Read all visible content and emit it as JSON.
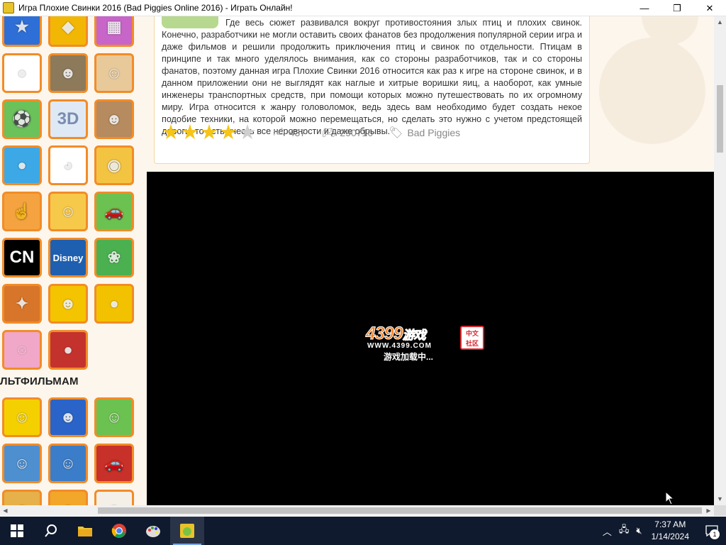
{
  "window": {
    "title": "Игра Плохие Свинки 2016 (Bad Piggies Online 2016) - Играть Онлайн!",
    "minimize_glyph": "—",
    "maximize_glyph": "❐",
    "close_glyph": "✕"
  },
  "sidebar": {
    "section_heading": "ЛЬТФИЛЬМАМ",
    "thumbs_top": [
      {
        "name": "game-thumb-stars",
        "label": "",
        "bg": "#2d6fd6",
        "glyph": "★"
      },
      {
        "name": "game-thumb-geometry",
        "label": "",
        "bg": "#f2b705",
        "glyph": "◆"
      },
      {
        "name": "game-thumb-blocks",
        "label": "",
        "bg": "#c765c9",
        "glyph": "▦"
      },
      {
        "name": "game-thumb-bubbles",
        "label": "",
        "bg": "#ffffff",
        "glyph": "●"
      },
      {
        "name": "game-thumb-jetpack",
        "label": "",
        "bg": "#8c7a5b",
        "glyph": "☻"
      },
      {
        "name": "game-thumb-viking",
        "label": "",
        "bg": "#e8c99a",
        "glyph": "☺"
      },
      {
        "name": "game-thumb-football",
        "label": "",
        "bg": "#6bc15a",
        "glyph": "⚽"
      },
      {
        "name": "game-thumb-3d",
        "label": "3D",
        "bg": "#dfe9f5",
        "glyph": ""
      },
      {
        "name": "game-thumb-gangster",
        "label": "",
        "bg": "#b58b5f",
        "glyph": "☻"
      },
      {
        "name": "game-thumb-angry-birds",
        "label": "",
        "bg": "#3da8e6",
        "glyph": "●"
      },
      {
        "name": "game-thumb-panda",
        "label": "",
        "bg": "#ffffff",
        "glyph": "◕"
      },
      {
        "name": "game-thumb-cut-rope",
        "label": "",
        "bg": "#f3c442",
        "glyph": "◉"
      },
      {
        "name": "game-thumb-clicker",
        "label": "",
        "bg": "#f4a340",
        "glyph": "☝"
      },
      {
        "name": "game-thumb-adam-eve",
        "label": "",
        "bg": "#f7c94a",
        "glyph": "☺"
      },
      {
        "name": "game-thumb-wheely",
        "label": "",
        "bg": "#6cc250",
        "glyph": "🚗"
      },
      {
        "name": "game-thumb-cartoon-network",
        "label": "CN",
        "bg": "#000000",
        "glyph": ""
      },
      {
        "name": "game-thumb-disney",
        "label": "Disney",
        "bg": "#1e5fb0",
        "glyph": ""
      },
      {
        "name": "game-thumb-candy",
        "label": "",
        "bg": "#4bb04f",
        "glyph": "❀"
      },
      {
        "name": "game-thumb-cannon",
        "label": "",
        "bg": "#d7752a",
        "glyph": "✦"
      },
      {
        "name": "game-thumb-brawl",
        "label": "",
        "bg": "#f5c400",
        "glyph": "☻"
      },
      {
        "name": "game-thumb-among-us",
        "label": "",
        "bg": "#f2c200",
        "glyph": "●"
      },
      {
        "name": "game-thumb-pop-it",
        "label": "",
        "bg": "#f0a7c8",
        "glyph": "◌"
      },
      {
        "name": "game-thumb-angry-bird-red",
        "label": "",
        "bg": "#c4322e",
        "glyph": "●"
      }
    ],
    "thumbs_bottom": [
      {
        "name": "game-thumb-spongebob",
        "label": "",
        "bg": "#f5d000",
        "glyph": "☺"
      },
      {
        "name": "game-thumb-sonic",
        "label": "",
        "bg": "#2a64c8",
        "glyph": "☻"
      },
      {
        "name": "game-thumb-paw-patrol",
        "label": "",
        "bg": "#6cc250",
        "glyph": "☺"
      },
      {
        "name": "game-thumb-gravity-falls",
        "label": "",
        "bg": "#4e8fd0",
        "glyph": "☺"
      },
      {
        "name": "game-thumb-tom-jerry",
        "label": "",
        "bg": "#3b7dc9",
        "glyph": "☺"
      },
      {
        "name": "game-thumb-cars",
        "label": "",
        "bg": "#c8302a",
        "glyph": "🚗"
      },
      {
        "name": "game-thumb-bottom-1",
        "label": "",
        "bg": "#e6b04a",
        "glyph": "☺"
      },
      {
        "name": "game-thumb-bottom-2",
        "label": "",
        "bg": "#f2a62a",
        "glyph": "☺"
      },
      {
        "name": "game-thumb-bottom-3",
        "label": "",
        "bg": "#f4f0e8",
        "glyph": "☺"
      }
    ]
  },
  "description": {
    "text": "Где весь сюжет развивался вокруг противостояния злых птиц и плохих свинок. Конечно, разработчики не могли оставить своих фанатов без продолжения популярной серии игра и даже фильмов и решили продолжить приключения птиц и свинок по отдельности. Птицам в принципе и так много уделялось внимания, как со стороны разработчиков, так и со стороны фанатов, поэтому данная игра Плохие Свинки 2016 относится как раз к игре на стороне свинок, и в данном приложении они не выглядят как наглые и хитрые воришки яиц, а наоборот, как умные инженеры транспортных средств, при помощи которых можно путешествовать по их огромному миру. Игра относится к жанру головоломок, ведь здесь вам необходимо будет создать некое подобие техники, на которой можно перемещаться, но сделать это нужно с учетом предстоящей дороги, то есть учесть все неровности и даже обрывы.",
    "rating": 4,
    "rating_max": 5,
    "likes": "437",
    "plays": "290716",
    "tag": "Bad Piggies"
  },
  "game": {
    "loader_logo": "4399",
    "loader_logo_cn": "游戏",
    "loader_url": "WWW.4399.COM",
    "loader_stamp": "中文\n社区",
    "loader_status": "游戏加载中..."
  },
  "taskbar": {
    "apps": [
      {
        "name": "start-button",
        "icon": "windows-icon"
      },
      {
        "name": "search-button",
        "icon": "search-icon"
      },
      {
        "name": "file-explorer-button",
        "icon": "folder-icon"
      },
      {
        "name": "chrome-button",
        "icon": "chrome-icon"
      },
      {
        "name": "paint-button",
        "icon": "paint-icon"
      },
      {
        "name": "bad-piggies-app-button",
        "icon": "bad-piggies-icon"
      }
    ],
    "time": "7:37 AM",
    "date": "1/14/2024",
    "notifications": "1"
  },
  "colors": {
    "accent_orange": "#f28c28",
    "star_on": "#f5c518",
    "star_off": "#cfcfcf",
    "taskbar_bg": "#0f1a2e"
  }
}
